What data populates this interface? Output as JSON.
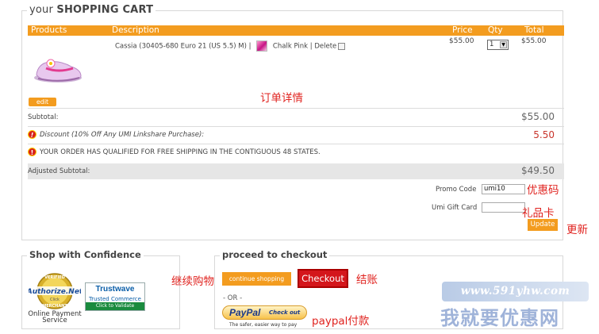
{
  "cart": {
    "title_prefix": "your",
    "title_main": "SHOPPING CART",
    "headers": {
      "products": "Products",
      "description": "Description",
      "price": "Price",
      "qty": "Qty",
      "total": "Total"
    },
    "item": {
      "name": "Cassia (30405-680 Euro 21 (US 5.5) M)",
      "color": "Chalk Pink",
      "delete_label": "Delete",
      "price": "$55.00",
      "qty": "1",
      "total": "$55.00"
    },
    "edit_label": "edit",
    "subtotal_label": "Subtotal:",
    "subtotal_value": "$55.00",
    "discount_label": "Discount (10% Off Any UMI Linkshare Purchase):",
    "discount_value": "5.50",
    "shipping_notice": "YOUR ORDER HAS QUALIFIED FOR FREE SHIPPING IN THE CONTIGUOUS 48 STATES.",
    "adjusted_label": "Adjusted Subtotal:",
    "adjusted_value": "$49.50",
    "promo_label": "Promo Code",
    "promo_value": "umi10",
    "gift_label": "Umi Gift Card",
    "gift_value": "",
    "update_label": "Update"
  },
  "annotations": {
    "order_details": "订单详情",
    "promo": "优惠码",
    "gift_card": "礼品卡",
    "update": "更新",
    "continue": "继续购物",
    "checkout": "结账",
    "paypal": "paypal付款"
  },
  "confidence": {
    "title": "Shop with Confidence",
    "authnet_top": "VERIFIED",
    "authnet_name": "Authorize.Net",
    "authnet_click": "Click",
    "authnet_bottom": "MERCHANT",
    "trustwave_name": "Trustwave",
    "trustwave_sub": "Trusted Commerce",
    "trustwave_validate": "Click to Validate",
    "online_payment": "Online Payment Service"
  },
  "checkout": {
    "title": "proceed to checkout",
    "continue_label": "continue shopping",
    "checkout_label": "Checkout",
    "or_label": "- OR -",
    "paypal_pay": "PayPal",
    "paypal_check": "Check out",
    "paypal_tagline": "The safer, easier way to pay"
  },
  "watermark": {
    "url": "www.591yhw.com",
    "name": "我就要优惠网"
  },
  "colors": {
    "accent_orange": "#f39c1f",
    "checkout_red": "#d4161b",
    "annotation_red": "#e0231f"
  }
}
